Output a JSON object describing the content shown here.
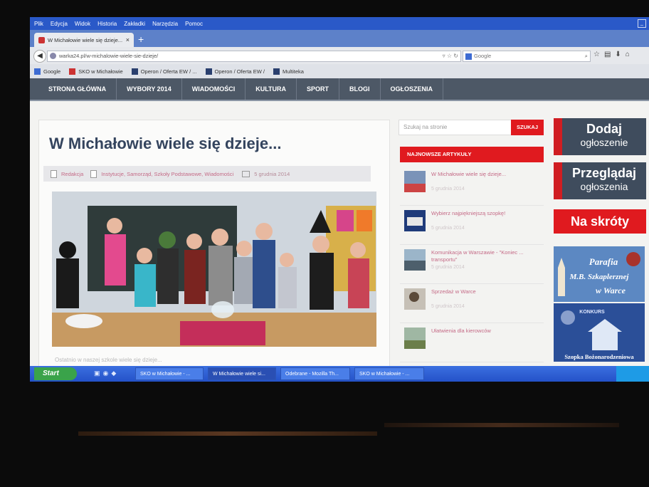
{
  "browser": {
    "menu": [
      "Plik",
      "Edycja",
      "Widok",
      "Historia",
      "Zakładki",
      "Narzędzia",
      "Pomoc"
    ],
    "tab_title": "W Michałowie wiele się dzieje...",
    "url": "warka24.pl/w-michalowie-wiele-sie-dzieje/",
    "search_engine": "Google",
    "bookmarks": [
      "Google",
      "SKO w Michałowie",
      "Operon / Oferta EW / ...",
      "Operon / Oferta EW /",
      "Multiteka"
    ]
  },
  "site_nav": [
    "STRONA GŁÓWNA",
    "WYBORY 2014",
    "WIADOMOŚCI",
    "KULTURA",
    "SPORT",
    "BLOGI",
    "OGŁOSZENIA"
  ],
  "article": {
    "title": "W Michałowie wiele się dzieje...",
    "author": "Redakcja",
    "categories": "Instytucje, Samorząd, Szkoły Podstawowe, Wiadomości",
    "date": "5 grudnia 2014",
    "excerpt": "Ostatnio w naszej szkole wiele się dzieje..."
  },
  "sidebar": {
    "search_placeholder": "Szukaj na stronie",
    "search_button": "SZUKAJ",
    "latest_heading": "NAJNOWSZE ARTYKUŁY",
    "latest": [
      {
        "title": "W Michałowie wiele się dzieje...",
        "date": "5 grudnia 2014"
      },
      {
        "title": "Wybierz najpiękniejszą szopkę!",
        "date": "5 grudnia 2014"
      },
      {
        "title": "Komunikacja w Warszawie - \"Koniec ... transportu\"",
        "date": "5 grudnia 2014"
      },
      {
        "title": "Sprzedaż w Warce",
        "date": "5 grudnia 2014"
      },
      {
        "title": "Ułatwienia dla kierowców",
        "date": ""
      }
    ]
  },
  "banners": {
    "dodaj_1": "Dodaj",
    "dodaj_2": "ogłoszenie",
    "przegladaj_1": "Przeglądaj",
    "przegladaj_2": "ogłoszenia",
    "skroty": "Na skróty",
    "parafia_1": "Parafia",
    "parafia_2": "M.B. Szkaplerznej",
    "parafia_3": "w Warce",
    "konkurs": "KONKURS",
    "szopka": "Szopka Bożonarodzeniowa"
  },
  "taskbar": {
    "start": "Start",
    "tasks": [
      "SKO w Michałowie - ...",
      "W Michałowie wiele si...",
      "Odebrane - Mozilla Th...",
      "SKO w Michałowie - ..."
    ]
  }
}
